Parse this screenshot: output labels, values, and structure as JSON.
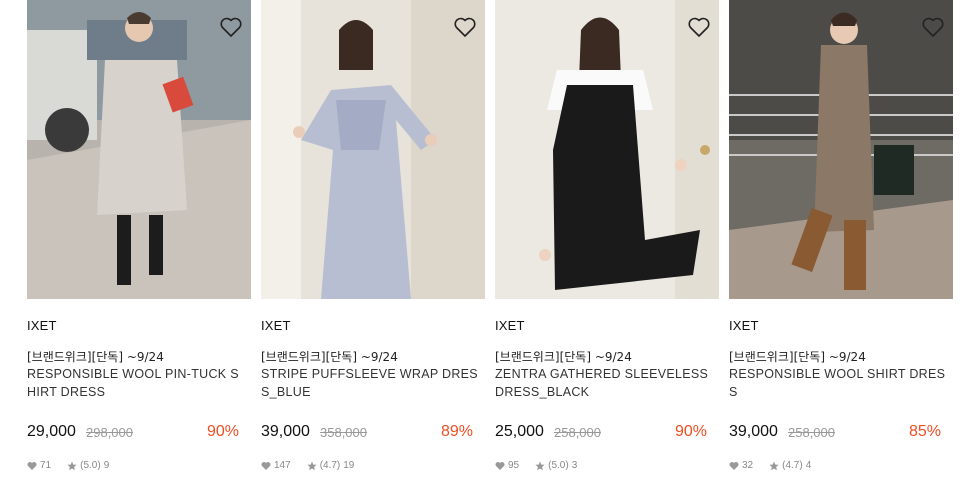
{
  "products": [
    {
      "brand": "IXET",
      "tag": "[브랜드위크][단독] ~9/24",
      "name": "RESPONSIBLE WOOL PIN-TUCK SHIRT DRESS",
      "price": "29,000",
      "original_price": "298,000",
      "discount": "90%",
      "likes": "71",
      "rating": "(5.0)",
      "reviews": "9",
      "image_alt": "woman in beige shirt dress with magazine"
    },
    {
      "brand": "IXET",
      "tag": "[브랜드위크][단독] ~9/24",
      "name": "STRIPE PUFFSLEEVE WRAP DRESS_BLUE",
      "price": "39,000",
      "original_price": "358,000",
      "discount": "89%",
      "likes": "147",
      "rating": "(4.7)",
      "reviews": "19",
      "image_alt": "woman in blue stripe wrap dress"
    },
    {
      "brand": "IXET",
      "tag": "[브랜드위크][단독] ~9/24",
      "name": "ZENTRA GATHERED SLEEVELESS DRESS_BLACK",
      "price": "25,000",
      "original_price": "258,000",
      "discount": "90%",
      "likes": "95",
      "rating": "(5.0)",
      "reviews": "3",
      "image_alt": "woman in black sleeveless dress over white tee"
    },
    {
      "brand": "IXET",
      "tag": "[브랜드위크][단독] ~9/24",
      "name": "RESPONSIBLE WOOL SHIRT DRESS",
      "price": "39,000",
      "original_price": "258,000",
      "discount": "85%",
      "likes": "32",
      "rating": "(4.7)",
      "reviews": "4",
      "image_alt": "woman in brown shirt dress with boots"
    }
  ],
  "colors": {
    "discount": "#f04e23",
    "text": "#222222",
    "muted": "#999999"
  },
  "icons": {
    "wishlist": "heart-outline-icon",
    "likes": "heart-filled-icon",
    "rating": "star-icon"
  }
}
